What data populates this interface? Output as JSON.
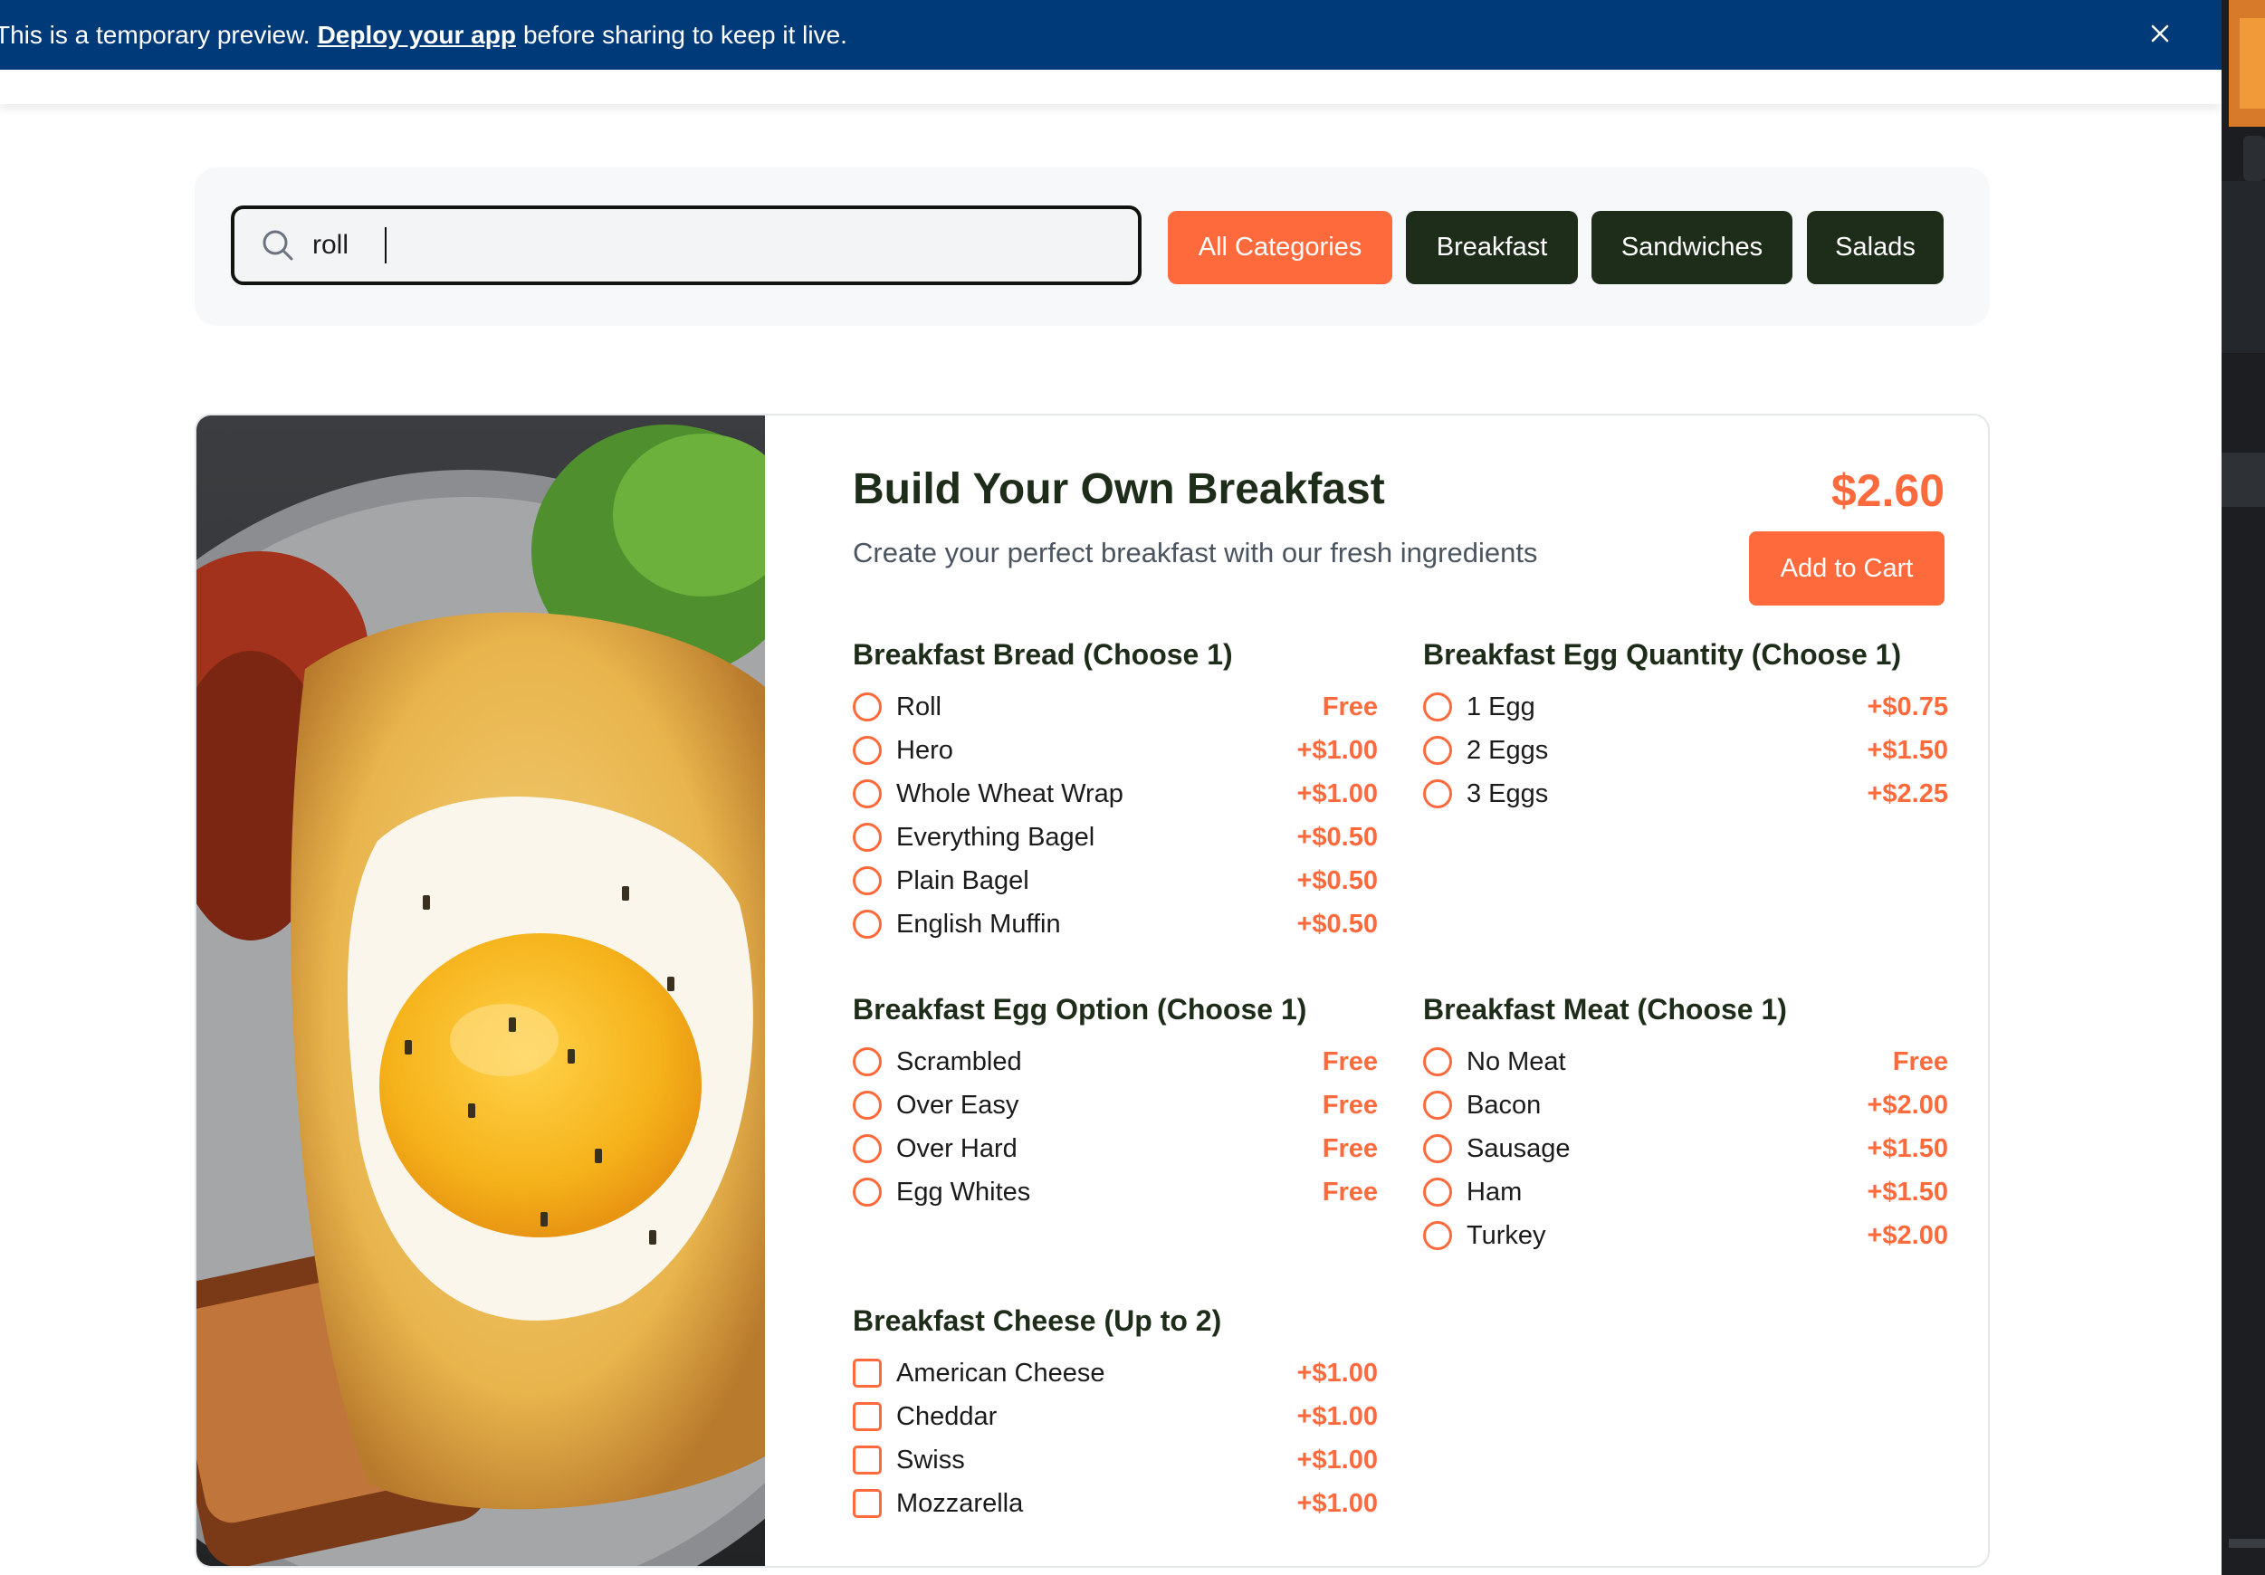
{
  "banner": {
    "text_before": "This is a temporary preview.",
    "link": "Deploy your app",
    "text_after": "before sharing to keep it live.",
    "close_icon": "close-icon"
  },
  "search": {
    "value": "roll",
    "icon": "search-icon"
  },
  "categories": [
    {
      "label": "All Categories",
      "active": true
    },
    {
      "label": "Breakfast",
      "active": false
    },
    {
      "label": "Sandwiches",
      "active": false
    },
    {
      "label": "Salads",
      "active": false
    }
  ],
  "product": {
    "title": "Build Your Own Breakfast",
    "description": "Create your perfect breakfast with our fresh ingredients",
    "price": "$2.60",
    "add_label": "Add to Cart"
  },
  "groups": {
    "bread": {
      "title": "Breakfast Bread (Choose 1)",
      "options": [
        {
          "label": "Roll",
          "price": "Free"
        },
        {
          "label": "Hero",
          "price": "+$1.00"
        },
        {
          "label": "Whole Wheat Wrap",
          "price": "+$1.00"
        },
        {
          "label": "Everything Bagel",
          "price": "+$0.50"
        },
        {
          "label": "Plain Bagel",
          "price": "+$0.50"
        },
        {
          "label": "English Muffin",
          "price": "+$0.50"
        }
      ]
    },
    "egg_quantity": {
      "title": "Breakfast Egg Quantity (Choose 1)",
      "options": [
        {
          "label": "1 Egg",
          "price": "+$0.75"
        },
        {
          "label": "2 Eggs",
          "price": "+$1.50"
        },
        {
          "label": "3 Eggs",
          "price": "+$2.25"
        }
      ]
    },
    "egg_option": {
      "title": "Breakfast Egg Option (Choose 1)",
      "options": [
        {
          "label": "Scrambled",
          "price": "Free"
        },
        {
          "label": "Over Easy",
          "price": "Free"
        },
        {
          "label": "Over Hard",
          "price": "Free"
        },
        {
          "label": "Egg Whites",
          "price": "Free"
        }
      ]
    },
    "meat": {
      "title": "Breakfast Meat (Choose 1)",
      "options": [
        {
          "label": "No Meat",
          "price": "Free"
        },
        {
          "label": "Bacon",
          "price": "+$2.00"
        },
        {
          "label": "Sausage",
          "price": "+$1.50"
        },
        {
          "label": "Ham",
          "price": "+$1.50"
        },
        {
          "label": "Turkey",
          "price": "+$2.00"
        }
      ]
    },
    "cheese": {
      "title": "Breakfast Cheese (Up to 2)",
      "options": [
        {
          "label": "American Cheese",
          "price": "+$1.00"
        },
        {
          "label": "Cheddar",
          "price": "+$1.00"
        },
        {
          "label": "Swiss",
          "price": "+$1.00"
        },
        {
          "label": "Mozzarella",
          "price": "+$1.00"
        }
      ]
    }
  },
  "colors": {
    "accent": "#ff6a3d",
    "dark_green": "#1e2d19",
    "banner": "#003a78"
  }
}
